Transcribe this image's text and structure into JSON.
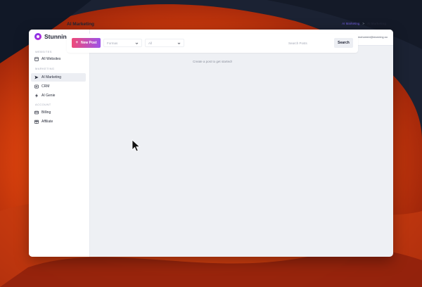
{
  "brand": {
    "name": "Stunning"
  },
  "sidebar": {
    "sections": [
      "WEBSITES",
      "MARKETING",
      "ACCOUNT"
    ],
    "items": [
      {
        "label": "All Websites",
        "icon": "website-icon"
      },
      {
        "label": "AI Marketing",
        "icon": "send-icon",
        "active": true
      },
      {
        "label": "CRM",
        "icon": "crm-icon"
      },
      {
        "label": "AI Genie",
        "icon": "bolt-icon"
      },
      {
        "label": "Billing",
        "icon": "billing-icon"
      },
      {
        "label": "Affiliate",
        "icon": "affiliate-icon"
      }
    ]
  },
  "topbar": {
    "user_email": "mohamed@stunning.so",
    "theme_icon": "moon-icon"
  },
  "page": {
    "title": "AI Marketing"
  },
  "breadcrumb": {
    "link": "AI Marketing",
    "separator": ">",
    "current": "AI Marketing"
  },
  "toolbar": {
    "new_post_label": "New Post",
    "platform_select": "Formas",
    "filter_select": "All",
    "search_placeholder": "Search Posts",
    "search_label": "Search"
  },
  "empty_state": "Create a post to get started!",
  "colors": {
    "accent": "#6d58d8",
    "gradient_start": "#ef4a78",
    "gradient_end": "#9d53e8"
  }
}
